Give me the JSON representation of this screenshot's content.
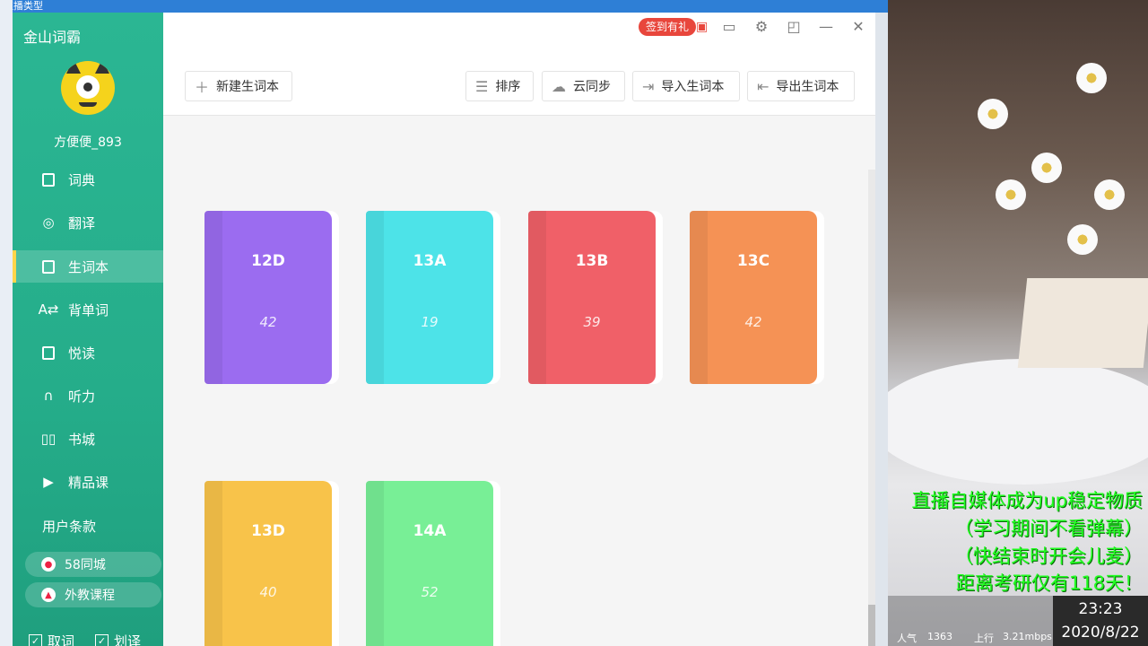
{
  "desktop": {
    "top_title": "直播类型"
  },
  "app": {
    "title": "金山词霸",
    "username": "方便便_893"
  },
  "nav": [
    {
      "label": "词典",
      "icon": "dictionary-icon"
    },
    {
      "label": "翻译",
      "icon": "translate-icon"
    },
    {
      "label": "生词本",
      "icon": "wordbook-icon",
      "active": true
    },
    {
      "label": "背单词",
      "icon": "memorize-icon"
    },
    {
      "label": "悦读",
      "icon": "reading-icon"
    },
    {
      "label": "听力",
      "icon": "headphones-icon"
    },
    {
      "label": "书城",
      "icon": "bookstore-icon"
    },
    {
      "label": "精品课",
      "icon": "course-icon"
    }
  ],
  "sidebar_footer": {
    "terms": "用户条款",
    "links": [
      "58同城",
      "外教课程"
    ],
    "checks": [
      "取词",
      "划译"
    ]
  },
  "topbar": {
    "signin": "签到有礼",
    "new_wordbook": "新建生词本",
    "sort": "排序",
    "cloud_sync": "云同步",
    "import": "导入生词本",
    "export": "导出生词本"
  },
  "wordbooks": [
    {
      "name": "12D",
      "count": "42",
      "color": "#9b6cf0"
    },
    {
      "name": "13A",
      "count": "19",
      "color": "#4de3e8"
    },
    {
      "name": "13B",
      "count": "39",
      "color": "#f06068"
    },
    {
      "name": "13C",
      "count": "42",
      "color": "#f59255"
    },
    {
      "name": "13D",
      "count": "40",
      "color": "#f8c34a"
    },
    {
      "name": "14A",
      "count": "52",
      "color": "#78ef96"
    }
  ],
  "stream": {
    "lines": [
      "直播自媒体成为up稳定物质",
      "（学习期间不看弹幕）",
      "（快结束时开会儿麦）",
      "距离考研仅有118天！"
    ],
    "time": "23:23",
    "date": "2020/8/22",
    "popularity_label": "人气",
    "popularity": "1363",
    "upload_label": "上行",
    "upload": "3.21mbps"
  }
}
